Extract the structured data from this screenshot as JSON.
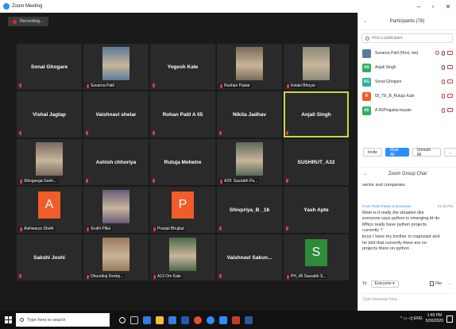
{
  "window": {
    "title": "Zoom Meeting",
    "minimize": "–",
    "restore": "▫",
    "close": "✕"
  },
  "recording": {
    "label": "Recording..."
  },
  "tiles": [
    {
      "name": "Sonal Ghogare",
      "kind": "name"
    },
    {
      "name": "Suvarna Patil",
      "kind": "photo",
      "color": "#5a7a9a"
    },
    {
      "name": "Yogesh Kale",
      "kind": "name"
    },
    {
      "name": "Roshan Pawar",
      "kind": "photo",
      "color": "#7a6a5a"
    },
    {
      "name": "Ketaki Bhoyar",
      "kind": "photo",
      "color": "#8a8a7a"
    },
    {
      "name": "Vishal Jagtap",
      "kind": "name"
    },
    {
      "name": "Vaishnavi shelar",
      "kind": "name"
    },
    {
      "name": "Rohan Patil A 05",
      "kind": "name"
    },
    {
      "name": "Nikita Jadhav",
      "kind": "name"
    },
    {
      "name": "Anjali Singh",
      "kind": "name",
      "active": true
    },
    {
      "name": "Shivganga Gavh...",
      "kind": "photo",
      "color": "#7a6a60"
    },
    {
      "name": "Ashish chhoriya",
      "kind": "name"
    },
    {
      "name": "Rutuja Mehetre",
      "kind": "name"
    },
    {
      "name": "A29: Saurabh Pa...",
      "kind": "photo",
      "color": "#5a6a5a"
    },
    {
      "name": "SUSHRUT_A32",
      "kind": "name"
    },
    {
      "name": "Aishwarya Sheth",
      "kind": "letter",
      "letter": "A",
      "color": "#f25c2a"
    },
    {
      "name": "Sruthi Pillai",
      "kind": "photo",
      "color": "#6a5a7a"
    },
    {
      "name": "Pranjal Bhujbal",
      "kind": "letter",
      "letter": "P",
      "color": "#f25c2a"
    },
    {
      "name": "Shivpriya_B _16",
      "kind": "name"
    },
    {
      "name": "Yash Apte",
      "kind": "name"
    },
    {
      "name": "Sakshi Joshi",
      "kind": "name"
    },
    {
      "name": "Dhundiraj Deshp...",
      "kind": "photo",
      "color": "#9a7a5a"
    },
    {
      "name": "A13 Om Kale",
      "kind": "photo",
      "color": "#4a6a4a"
    },
    {
      "name": "Vaishnavi  Sakun...",
      "kind": "name"
    },
    {
      "name": "PH_46 Saurabh S...",
      "kind": "letter",
      "letter": "S",
      "color": "#2e8b3a"
    }
  ],
  "participants": {
    "title": "Participants (78)",
    "search_placeholder": "Find a participant",
    "list": [
      {
        "name": "Suvarna Patil (Host, me)",
        "initials": "",
        "color": "#5a7a9a",
        "mic": "gray",
        "rec": true
      },
      {
        "name": "Anjali Singh",
        "initials": "AS",
        "color": "#2fae5f",
        "mic": "gray",
        "rec": false
      },
      {
        "name": "Sonal Ghogare",
        "initials": "SG",
        "color": "#2fae9a",
        "mic": "red",
        "rec": false
      },
      {
        "name": "65_TE_B_Rutuja Kale",
        "initials": "R",
        "color": "#f25c2a",
        "mic": "red",
        "rec": false
      },
      {
        "name": "A 56/Prajakta koyate",
        "initials": "A5",
        "color": "#2fae5f",
        "mic": "red",
        "rec": false
      }
    ],
    "buttons": {
      "invite": "Invite",
      "mute_all": "Mute All",
      "unmute_all": "Unmute All",
      "more": "..."
    }
  },
  "chat": {
    "title": "Zoom Group Chat",
    "previous_message": "sector and companies",
    "message": {
      "from": "From Rohit Pawar to Everyone",
      "time": "01:48 PM",
      "lines": [
        "Mam is it really the situation like",
        "everyone says python is emerging bt do",
        "MNcs really have python projects",
        "currently  ?",
        "bcoz I have my brother in cognizant and",
        "he told that currently there are no",
        "projects there on python ."
      ]
    },
    "to_label": "To:",
    "to_value": "Everyone ▾",
    "file_label": "File",
    "more": "...",
    "input_placeholder": "Type message here..."
  },
  "taskbar": {
    "search_placeholder": "Type here to search",
    "time": "1:49 PM",
    "date": "5/30/2020",
    "tray_icons": "^ ▭ ◁) ENG"
  }
}
